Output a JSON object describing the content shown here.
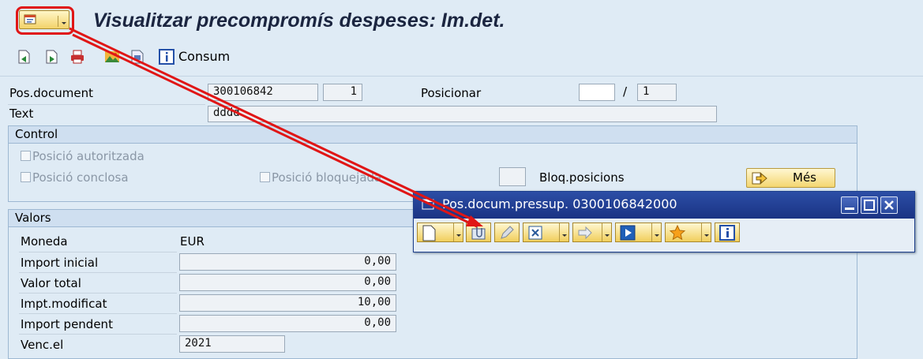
{
  "title": "Visualitzar precompromís despeses: Im.det.",
  "toolbar": {
    "consum_label": "Consum"
  },
  "header": {
    "pos_document_label": "Pos.document",
    "pos_document_value": "300106842",
    "pos_document_item": "1",
    "posicionar_label": "Posicionar",
    "posicionar_value": "",
    "posicionar_sep": "/",
    "posicionar_total": "1",
    "text_label": "Text",
    "text_value": "dddd"
  },
  "control": {
    "title": "Control",
    "posicio_autoritzada": "Posició autoritzada",
    "posicio_conclosa": "Posició conclosa",
    "posicio_bloquejada": "Posició bloquejada",
    "bloq_posicions": "Bloq.posicions",
    "mes_label": "Més"
  },
  "valors": {
    "title": "Valors",
    "moneda_label": "Moneda",
    "moneda_value": "EUR",
    "import_inicial_label": "Import inicial",
    "import_inicial_value": "0,00",
    "valor_total_label": "Valor total",
    "valor_total_value": "0,00",
    "impt_modificat_label": "Impt.modificat",
    "impt_modificat_value": "10,00",
    "import_pendent_label": "Import pendent",
    "import_pendent_value": "0,00",
    "venc_el_label": "Venc.el",
    "venc_el_value": "2021"
  },
  "popup": {
    "title": "Pos.docum.pressup. 0300106842000"
  },
  "colors": {
    "highlight": "#e01616",
    "popup_header": "#1f3b8f",
    "button_yellow": "#f4d670"
  }
}
